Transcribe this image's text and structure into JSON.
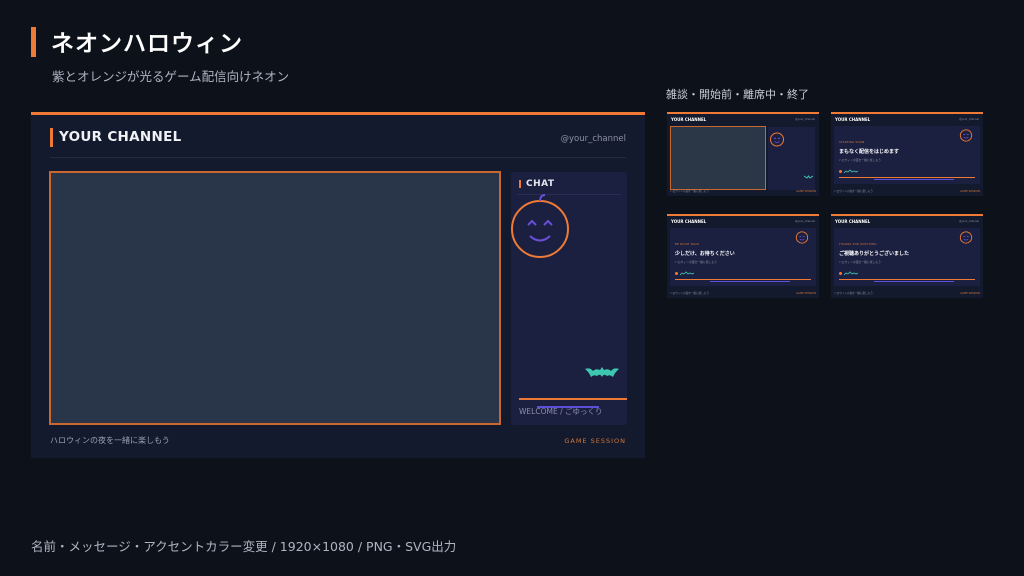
{
  "header": {
    "title": "ネオンハロウィン",
    "subtitle": "紫とオレンジが光るゲーム配信向けネオン"
  },
  "variants_label": "雑談・開始前・離席中・終了",
  "preview": {
    "channel_name": "YOUR CHANNEL",
    "handle": "@your_channel",
    "chat_label": "CHAT",
    "chat_welcome": "WELCOME / ごゆっくり",
    "caption": "ハロウィンの夜を一緒に楽しもう",
    "session_label": "GAME SESSION"
  },
  "thumbnails": [
    {
      "channel_name": "YOUR CHANNEL",
      "handle": "@your_channel",
      "kind": "chat"
    },
    {
      "channel_name": "YOUR CHANNEL",
      "handle": "@your_channel",
      "kind": "message",
      "tag": "STARTING SOON",
      "message": "まもなく配信をはじめます",
      "sub": "ハロウィンの夜を一緒に楽しもう"
    },
    {
      "channel_name": "YOUR CHANNEL",
      "handle": "@your_channel",
      "kind": "message",
      "tag": "BE RIGHT BACK",
      "message": "少しだけ、お待ちください",
      "sub": "ハロウィンの夜を一緒に楽しもう"
    },
    {
      "channel_name": "YOUR CHANNEL",
      "handle": "@your_channel",
      "kind": "message",
      "tag": "THANKS FOR WATCHING",
      "message": "ご視聴ありがとうございました",
      "sub": "ハロウィンの夜を一緒に楽しもう"
    }
  ],
  "thumbnail_footer": {
    "caption": "ハロウィンの夜を一緒に楽しもう",
    "session": "GAME SESSION"
  },
  "footer": "名前・メッセージ・アクセントカラー変更 / 1920×1080 / PNG・SVG出力",
  "colors": {
    "accent": "#ee7a35",
    "purple": "#6a4fd8",
    "teal": "#3ec7b0",
    "background": "#0d111a",
    "panel": "#141a2d"
  },
  "icons": [
    "pumpkin-icon",
    "bat-icon"
  ]
}
